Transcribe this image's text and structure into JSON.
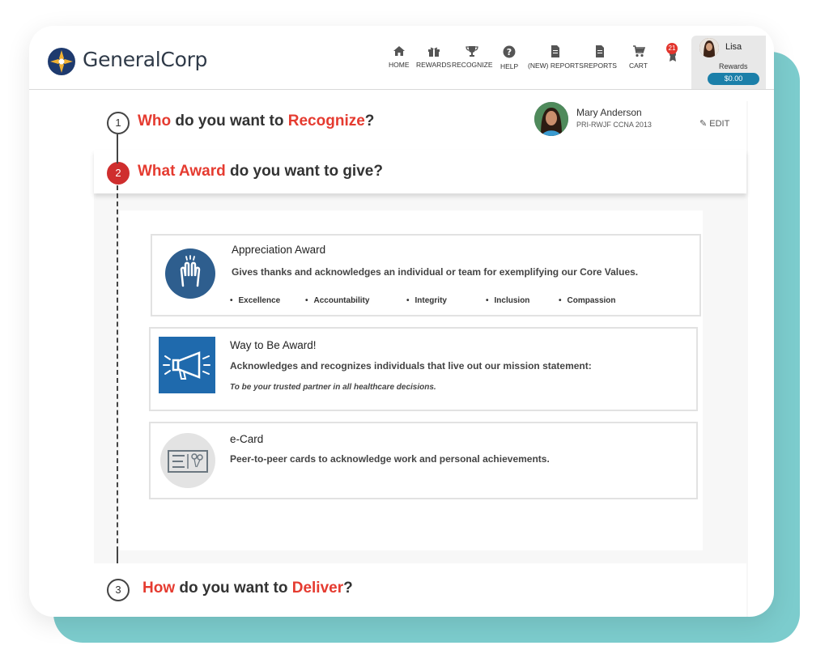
{
  "brand": {
    "name": "GeneralCorp"
  },
  "nav": [
    {
      "label": "HOME",
      "icon": "home-icon"
    },
    {
      "label": "REWARDS",
      "icon": "gift-icon"
    },
    {
      "label": "RECOGNIZE",
      "icon": "trophy-icon"
    },
    {
      "label": "HELP",
      "icon": "help-icon"
    },
    {
      "label": "(NEW) REPORTS",
      "icon": "document-icon"
    },
    {
      "label": "REPORTS",
      "icon": "document-icon"
    },
    {
      "label": "CART",
      "icon": "cart-icon"
    }
  ],
  "notifications": {
    "count": "21"
  },
  "user": {
    "name": "Lisa",
    "rewards_label": "Rewards",
    "rewards_amount": "$0.00"
  },
  "steps": {
    "s1": {
      "num": "1",
      "pre": "",
      "hl1": "Who",
      "mid": " do you want to ",
      "hl2": "Recognize",
      "post": "?"
    },
    "s2": {
      "num": "2",
      "hl1": "What Award",
      "mid": " do you want to give?"
    },
    "s3": {
      "num": "3",
      "hl1": "How",
      "mid": " do you want to ",
      "hl2": "Deliver",
      "post": "?"
    }
  },
  "recipient": {
    "name": "Mary Anderson",
    "subtitle": "PRI-RWJF CCNA 2013",
    "edit_label": "✎ EDIT"
  },
  "awards": [
    {
      "title": "Appreciation Award",
      "description": "Gives thanks and acknowledges an individual or team for exemplifying our Core Values.",
      "values": [
        "Excellence",
        "Accountability",
        "Integrity",
        "Inclusion",
        "Compassion"
      ]
    },
    {
      "title": "Way to Be Award!",
      "description": "Acknowledges and recognizes individuals that live out our mission statement:",
      "note": "To be your trusted partner in all healthcare decisions."
    },
    {
      "title": "e-Card",
      "description": "Peer-to-peer cards to acknowledge work and personal achievements."
    }
  ],
  "colors": {
    "accent": "#e53b30",
    "teal": "#7ccccd",
    "brand_blue": "#1f6aad"
  }
}
